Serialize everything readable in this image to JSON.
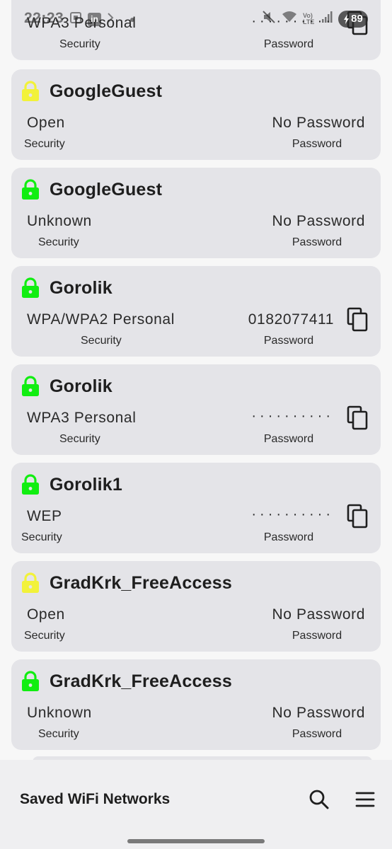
{
  "status_bar": {
    "time": "22:23",
    "battery_level": "89",
    "left_icons": [
      "screenshot-icon",
      "linkedin-icon",
      "chevron-icon",
      "dot-icon"
    ],
    "right_icons": [
      "mute-icon",
      "wifi-icon",
      "volte-icon",
      "signal-icon",
      "battery-icon"
    ],
    "linkedin_label": "in",
    "volte_label": "Vo) LTE"
  },
  "colors": {
    "lock_green": "#11ee11",
    "lock_yellow": "#f2f23a",
    "card_bg": "#e4e4e8",
    "bar_bg": "#efeff1"
  },
  "networks": [
    {
      "name": "",
      "security": "WPA3 Personal",
      "security_caption": "Security",
      "password": "··········",
      "password_caption": "Password",
      "lock": "green",
      "copy": true
    },
    {
      "name": "GoogleGuest",
      "security": "Open",
      "security_caption": "Security",
      "password": "No Password",
      "password_caption": "Password",
      "lock": "yellow",
      "copy": false
    },
    {
      "name": "GoogleGuest",
      "security": "Unknown",
      "security_caption": "Security",
      "password": "No Password",
      "password_caption": "Password",
      "lock": "green",
      "copy": false
    },
    {
      "name": "Gorolik",
      "security": "WPA/WPA2 Personal",
      "security_caption": "Security",
      "password": "0182077411",
      "password_caption": "Password",
      "lock": "green",
      "copy": true
    },
    {
      "name": "Gorolik",
      "security": "WPA3 Personal",
      "security_caption": "Security",
      "password": "··········",
      "password_caption": "Password",
      "lock": "green",
      "copy": true
    },
    {
      "name": "Gorolik1",
      "security": "WEP",
      "security_caption": "Security",
      "password": "··········",
      "password_caption": "Password",
      "lock": "green",
      "copy": true
    },
    {
      "name": "GradKrk_FreeAccess",
      "security": "Open",
      "security_caption": "Security",
      "password": "No Password",
      "password_caption": "Password",
      "lock": "yellow",
      "copy": false
    },
    {
      "name": "GradKrk_FreeAccess",
      "security": "Unknown",
      "security_caption": "Security",
      "password": "No Password",
      "password_caption": "Password",
      "lock": "green",
      "copy": false
    }
  ],
  "bottom_bar": {
    "title": "Saved WiFi Networks",
    "search_icon": "search-icon",
    "menu_icon": "menu-icon"
  }
}
